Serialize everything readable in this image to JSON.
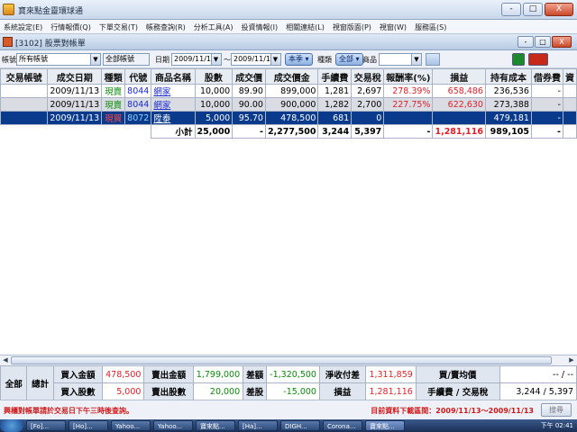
{
  "app": {
    "title": "寶來點金靈環球通",
    "menus": [
      "系統設定(E)",
      "行情報價(Q)",
      "下單交易(T)",
      "帳務查詢(R)",
      "分析工具(A)",
      "投資情報(I)",
      "相關連結(L)",
      "視窗版面(P)",
      "視窗(W)",
      "服務區(S)"
    ],
    "min_label": "-",
    "max_label": "□",
    "close_label": "X"
  },
  "child": {
    "title": "[3102] 股票對帳單",
    "min_label": "-",
    "max_label": "□",
    "close_label": "X"
  },
  "filter": {
    "account_label": "帳號",
    "account_value": "所有帳號",
    "all_accounts_label": "全部帳號",
    "date_label": "日期",
    "date_from": "2009/11/13",
    "date_sep": "～",
    "date_to": "2009/11/13",
    "period_button": "本季",
    "type_label": "種類",
    "type_value": "全部",
    "product_label": "商品",
    "product_value": "",
    "arrow": "▼",
    "small_arrow": "▾",
    "excel_icon_color": "#1a8a2a",
    "print_icon_color": "#c82818"
  },
  "table": {
    "headers": [
      "交易帳號",
      "成交日期",
      "種類",
      "代號",
      "商品名稱",
      "股數",
      "成交價",
      "成交價金",
      "手續費",
      "交易稅",
      "報酬率(%)",
      "損益",
      "持有成本",
      "借券費",
      "資"
    ],
    "rows": [
      {
        "account": "",
        "date": "2009/11/13",
        "kind": "現賣",
        "code": "8044",
        "name": "網家",
        "shares": "10,000",
        "price": "89.90",
        "amount": "899,000",
        "fee": "1,281",
        "tax": "2,697",
        "roi": "278.39%",
        "pnl": "658,486",
        "cost": "236,536",
        "loan": "-"
      },
      {
        "account": "",
        "date": "2009/11/13",
        "kind": "現賣",
        "code": "8044",
        "name": "網家",
        "shares": "10,000",
        "price": "90.00",
        "amount": "900,000",
        "fee": "1,282",
        "tax": "2,700",
        "roi": "227.75%",
        "pnl": "622,630",
        "cost": "273,388",
        "loan": "-"
      },
      {
        "account": "",
        "date": "2009/11/13",
        "kind": "現買",
        "code": "8072",
        "name": "陞泰",
        "shares": "5,000",
        "price": "95.70",
        "amount": "478,500",
        "fee": "681",
        "tax": "0",
        "roi": "",
        "pnl": "",
        "cost": "479,181",
        "loan": "-"
      }
    ],
    "subtotal": {
      "label": "小計",
      "shares": "25,000",
      "price": "-",
      "amount": "2,277,500",
      "fee": "3,244",
      "tax": "5,397",
      "roi": "-",
      "pnl": "1,281,116",
      "cost": "989,105",
      "loan": "-"
    }
  },
  "summary": {
    "all_label": "全部",
    "total_label": "總計",
    "buy_amount_label": "買入金額",
    "buy_amount": "478,500",
    "sell_amount_label": "賣出金額",
    "sell_amount": "1,799,000",
    "diff_amount_label": "差額",
    "diff_amount": "-1,320,500",
    "net_label": "淨收付差",
    "net": "1,311,859",
    "avg_label": "買/賣均價",
    "avg": "-- / --",
    "buy_shares_label": "買入股數",
    "buy_shares": "5,000",
    "sell_shares_label": "賣出股數",
    "sell_shares": "20,000",
    "diff_shares_label": "差股",
    "diff_shares": "-15,000",
    "pnl_label": "損益",
    "pnl": "1,281,116",
    "fee_tax_label": "手續費 / 交易稅",
    "fee_tax": "3,244 / 5,397"
  },
  "status": {
    "note": "興櫃對帳單請於交易日下午三時後查詢。",
    "range": "目前資料下載區間：2009/11/13～2009/11/13",
    "search_button": "搜尋"
  },
  "taskbar": {
    "tasks": [
      "[Fo]...",
      "[Ho]...",
      "Yahoo...",
      "Yahoo...",
      "寶來點...",
      "[Ha]...",
      "DIGH...",
      "Corona...",
      "寶來點..."
    ],
    "clock": "下午 02:41"
  }
}
